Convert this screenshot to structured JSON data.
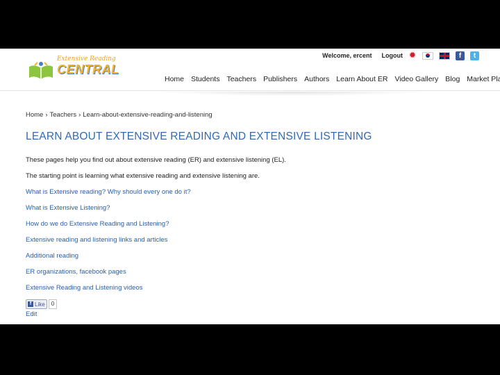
{
  "header": {
    "welcome": "Welcome, ercent",
    "logout": "Logout",
    "logo": {
      "tagline": "Extensive Reading",
      "brand": "CENTRAL"
    },
    "nav": [
      "Home",
      "Students",
      "Teachers",
      "Publishers",
      "Authors",
      "Learn About ER",
      "Video Gallery",
      "Blog",
      "Market Place"
    ],
    "icons": [
      "maple-leaf-icon",
      "korea-flag-icon",
      "uk-flag-icon",
      "facebook-icon",
      "twitter-icon"
    ]
  },
  "breadcrumb": [
    "Home",
    "Teachers",
    "Learn-about-extensive-reading-and-listening"
  ],
  "page": {
    "title": "LEARN ABOUT EXTENSIVE READING AND EXTENSIVE LISTENING",
    "intro1": "These pages help you find out about extensive reading (ER) and extensive listening (EL).",
    "intro2": "The starting point is learning what extensive reading and extensive listening are.",
    "links": [
      "What is Extensive reading? Why should every one do it?",
      "What is Extensive Listening?",
      "How do we do Extensive Reading and Listening?",
      "Extensive reading and listening links and articles",
      "Additional reading",
      "ER organizations, facebook pages",
      "Extensive Reading and Listening videos"
    ],
    "like_label": "Like",
    "like_count": "0",
    "edit": "Edit"
  },
  "colors": {
    "title": "#2f6bb5",
    "link": "#2b5fa8",
    "brand": "#f3b52b"
  }
}
